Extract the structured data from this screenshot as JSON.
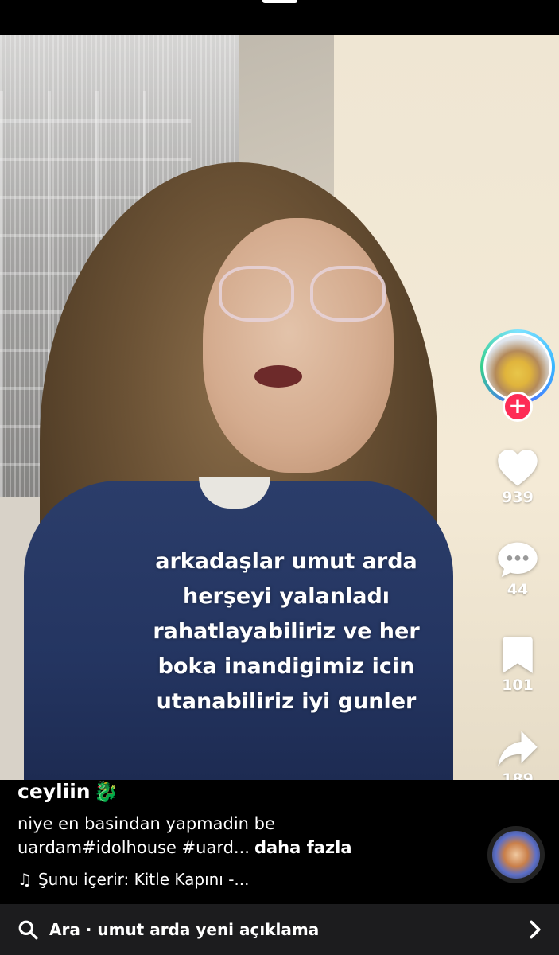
{
  "video": {
    "caption_lines": [
      "arkadaşlar umut arda",
      "herşeyi yalanladı",
      "rahatlayabiliriz ve her",
      "boka inandigimiz icin",
      "utanabiliriz iyi gunler"
    ]
  },
  "actions": {
    "likes": "939",
    "comments": "44",
    "saves": "101",
    "shares": "189"
  },
  "post": {
    "username": "ceyliin",
    "username_emoji": "🐉",
    "description_line1": "niye en basindan yapmadin be",
    "description_line2": "uardam#idolhouse #uard...",
    "more_label": "daha fazla",
    "music_label": "Şunu içerir: Kitle Kapını -..."
  },
  "search": {
    "text": "Ara · umut arda yeni açıklama"
  },
  "colors": {
    "follow": "#fe2c55",
    "search_bg": "#1c1c1e"
  }
}
